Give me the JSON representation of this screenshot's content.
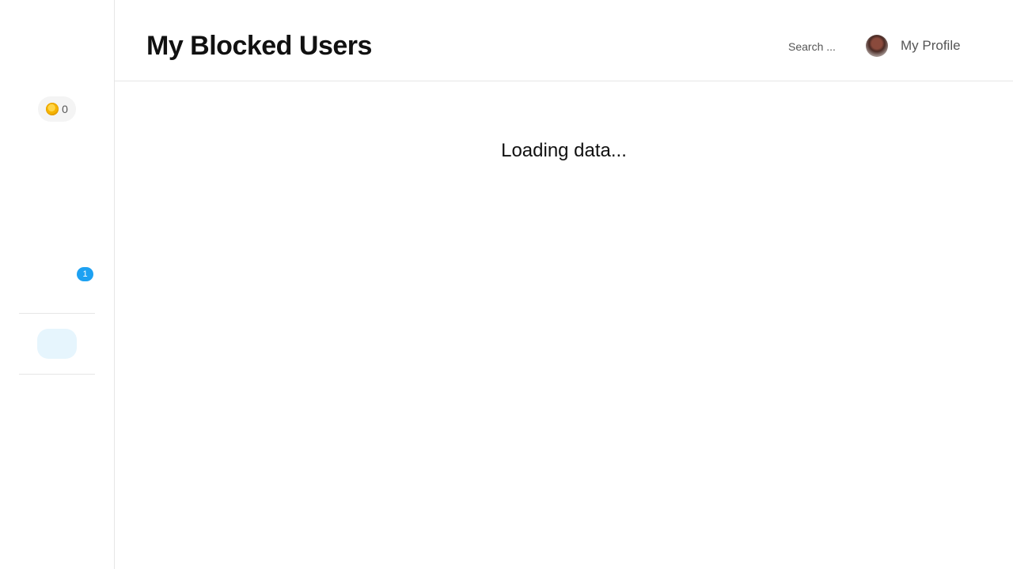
{
  "sidebar": {
    "coins": {
      "icon": "coin-icon",
      "count": "0"
    },
    "notification_badge": "1",
    "accent_color": "#1da1f2"
  },
  "header": {
    "title": "My Blocked Users",
    "search": {
      "placeholder": "Search ...",
      "value": ""
    },
    "profile": {
      "label": "My Profile",
      "avatar_icon": "avatar"
    }
  },
  "main": {
    "status_text": "Loading data..."
  }
}
